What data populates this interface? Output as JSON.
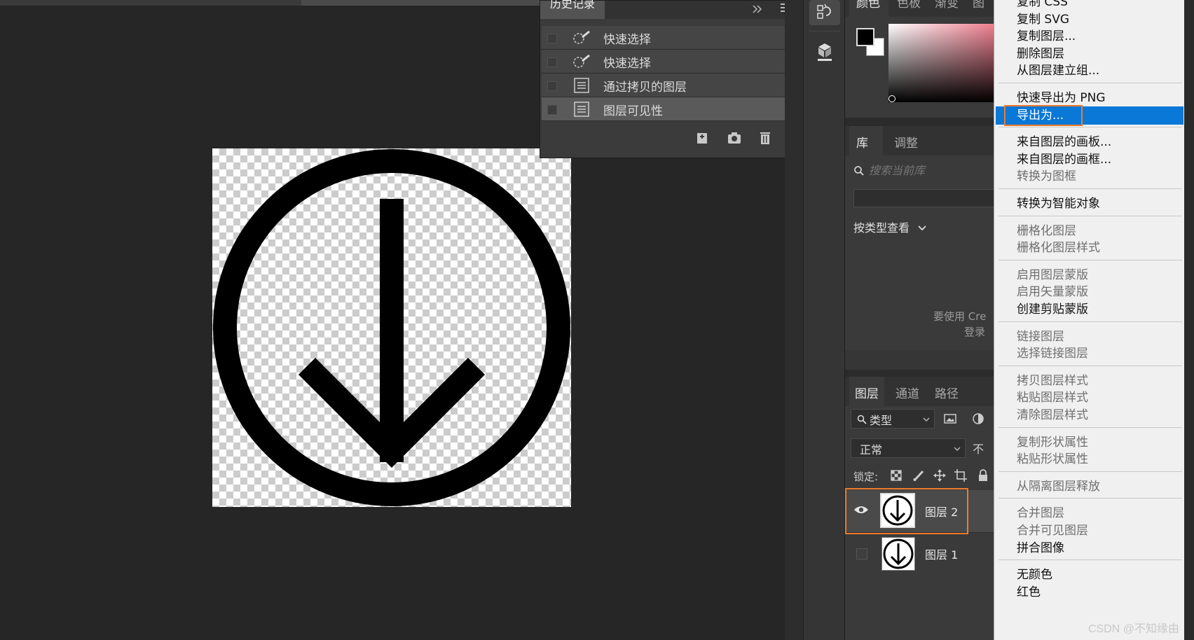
{
  "history_panel": {
    "tab": "历史记录",
    "items": [
      {
        "label": "快速选择",
        "icon": "quick-select-icon"
      },
      {
        "label": "快速选择",
        "icon": "quick-select-icon"
      },
      {
        "label": "通过拷贝的图层",
        "icon": "document-icon"
      },
      {
        "label": "图层可见性",
        "icon": "document-icon"
      }
    ]
  },
  "color_panel": {
    "tabs": [
      "颜色",
      "色板",
      "渐变",
      "图"
    ]
  },
  "library_panel": {
    "tabs": [
      "库",
      "调整"
    ],
    "search_placeholder": "搜索当前库",
    "view_by": "按类型查看",
    "message_line1": "要使用 Cre",
    "message_line2": "登录"
  },
  "layers_panel": {
    "tabs": [
      "图层",
      "通道",
      "路径"
    ],
    "filter": "类型",
    "blend_mode": "正常",
    "opacity_label": "不",
    "lock_label": "锁定:",
    "layers": [
      {
        "name": "图层 2",
        "visible": true,
        "selected": true
      },
      {
        "name": "图层 1",
        "visible": false,
        "selected": false
      }
    ]
  },
  "context_menu": {
    "groups": [
      [
        {
          "label": "复制 CSS",
          "disabled": false
        },
        {
          "label": "复制 SVG",
          "disabled": false
        },
        {
          "label": "复制图层...",
          "disabled": false
        },
        {
          "label": "删除图层",
          "disabled": false
        },
        {
          "label": "从图层建立组...",
          "disabled": false
        }
      ],
      [
        {
          "label": "快速导出为 PNG",
          "disabled": false
        },
        {
          "label": "导出为...",
          "disabled": false,
          "highlighted": true
        }
      ],
      [
        {
          "label": "来自图层的画板...",
          "disabled": false
        },
        {
          "label": "来自图层的画框...",
          "disabled": false
        },
        {
          "label": "转换为图框",
          "disabled": true
        }
      ],
      [
        {
          "label": "转换为智能对象",
          "disabled": false
        }
      ],
      [
        {
          "label": "栅格化图层",
          "disabled": true
        },
        {
          "label": "栅格化图层样式",
          "disabled": true
        }
      ],
      [
        {
          "label": "启用图层蒙版",
          "disabled": true
        },
        {
          "label": "启用矢量蒙版",
          "disabled": true
        },
        {
          "label": "创建剪贴蒙版",
          "disabled": false
        }
      ],
      [
        {
          "label": "链接图层",
          "disabled": true
        },
        {
          "label": "选择链接图层",
          "disabled": true
        }
      ],
      [
        {
          "label": "拷贝图层样式",
          "disabled": true
        },
        {
          "label": "粘贴图层样式",
          "disabled": true
        },
        {
          "label": "清除图层样式",
          "disabled": true
        }
      ],
      [
        {
          "label": "复制形状属性",
          "disabled": true
        },
        {
          "label": "粘贴形状属性",
          "disabled": true
        }
      ],
      [
        {
          "label": "从隔离图层释放",
          "disabled": true
        }
      ],
      [
        {
          "label": "合并图层",
          "disabled": true
        },
        {
          "label": "合并可见图层",
          "disabled": true
        },
        {
          "label": "拼合图像",
          "disabled": false
        }
      ],
      [
        {
          "label": "无颜色",
          "disabled": false
        },
        {
          "label": "红色",
          "disabled": false
        }
      ]
    ]
  },
  "colors": {
    "accent": "#0a78d7",
    "highlight_box": "#f07a2a",
    "foreground": "#000000",
    "background": "#ffffff"
  },
  "watermark": "CSDN @不知缘由"
}
